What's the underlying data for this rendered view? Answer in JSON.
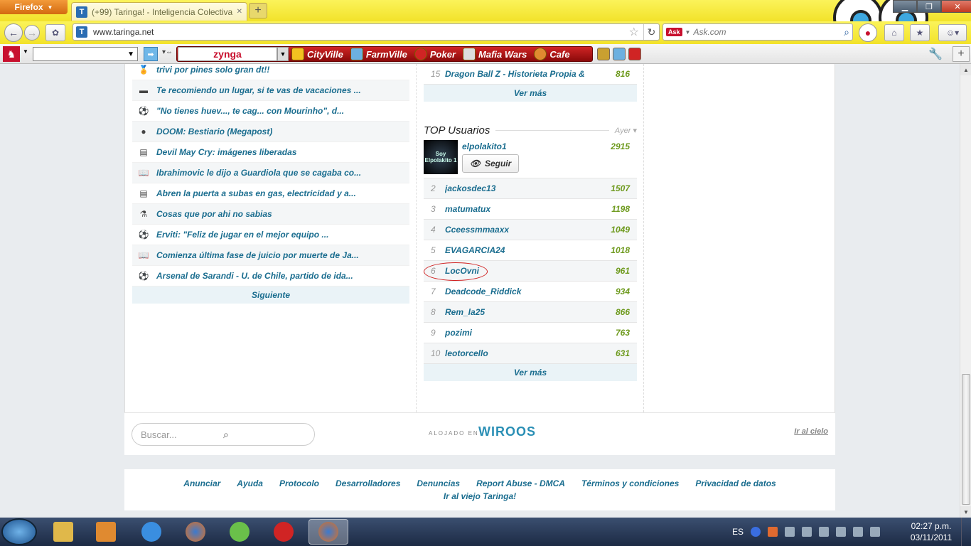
{
  "browser": {
    "menu_label": "Firefox",
    "tab_title": "(+99) Taringa! - Inteligencia Colectiva",
    "url": "www.taringa.net",
    "search_placeholder": "Ask.com",
    "search_logo": "Ask"
  },
  "toolbar": {
    "zynga_logo": "zynga",
    "games": [
      "CityVille",
      "FarmVille",
      "Poker",
      "Mafia Wars",
      "Cafe"
    ]
  },
  "posts": [
    {
      "icon": "trophy-icon",
      "glyph": "🏅",
      "title": "trivi por pines solo gran dt!!"
    },
    {
      "icon": "travel-icon",
      "glyph": "▬",
      "title": "Te recomiendo un lugar, si te vas de vacaciones ..."
    },
    {
      "icon": "soccer-ball-icon",
      "glyph": "⚽",
      "title": "\"No tienes huev..., te cag... con Mourinho\", d..."
    },
    {
      "icon": "ghost-icon",
      "glyph": "●",
      "title": "DOOM: Bestiario (Megapost)"
    },
    {
      "icon": "news-icon",
      "glyph": "▤",
      "title": "Devil May Cry: imágenes liberadas"
    },
    {
      "icon": "book-icon",
      "glyph": "📖",
      "title": "Ibrahimovic le dijo a Guardiola que se cagaba co..."
    },
    {
      "icon": "news-icon",
      "glyph": "▤",
      "title": "Abren la puerta a subas en gas, electricidad y a..."
    },
    {
      "icon": "flask-icon",
      "glyph": "⚗",
      "title": "Cosas que por ahi no sabias"
    },
    {
      "icon": "soccer-ball-icon",
      "glyph": "⚽",
      "title": "Erviti: \"Feliz de jugar en el mejor equipo ..."
    },
    {
      "icon": "book-icon",
      "glyph": "📖",
      "title": "Comienza última fase de juicio por muerte de Ja..."
    },
    {
      "icon": "soccer-ball-icon",
      "glyph": "⚽",
      "title": "Arsenal de Sarandi - U. de Chile, partido de ida..."
    }
  ],
  "posts_next": "Siguiente",
  "top_posts": {
    "last_row": {
      "rank": "15",
      "title": "Dragon Ball Z - Historieta Propia &",
      "score": "816"
    },
    "more": "Ver más"
  },
  "top_users": {
    "title": "TOP Usuarios",
    "period": "Ayer",
    "first": {
      "name": "elpolakito1",
      "score": "2915",
      "avatar_text": "Soy Elpolakito 1",
      "follow": "Seguir"
    },
    "rows": [
      {
        "rank": "2",
        "name": "jackosdec13",
        "score": "1507"
      },
      {
        "rank": "3",
        "name": "matumatux",
        "score": "1198"
      },
      {
        "rank": "4",
        "name": "Cceessmmaaxx",
        "score": "1049"
      },
      {
        "rank": "5",
        "name": "EVAGARCIA24",
        "score": "1018"
      },
      {
        "rank": "6",
        "name": "LocOvni",
        "score": "961"
      },
      {
        "rank": "7",
        "name": "Deadcode_Riddick",
        "score": "934"
      },
      {
        "rank": "8",
        "name": "Rem_la25",
        "score": "866"
      },
      {
        "rank": "9",
        "name": "pozimi",
        "score": "763"
      },
      {
        "rank": "10",
        "name": "leotorcello",
        "score": "631"
      }
    ],
    "more": "Ver más"
  },
  "footer": {
    "search_placeholder": "Buscar...",
    "hosted_by": "ALOJADO EN",
    "host": "WIROOS",
    "to_top": "Ir al cielo",
    "links": [
      "Anunciar",
      "Ayuda",
      "Protocolo",
      "Desarrolladores",
      "Denuncias",
      "Report Abuse - DMCA",
      "Términos y condiciones",
      "Privacidad de datos",
      "Ir al viejo Taringa!"
    ]
  },
  "taskbar": {
    "lang": "ES",
    "time": "02:27 p.m.",
    "date": "03/11/2011"
  }
}
